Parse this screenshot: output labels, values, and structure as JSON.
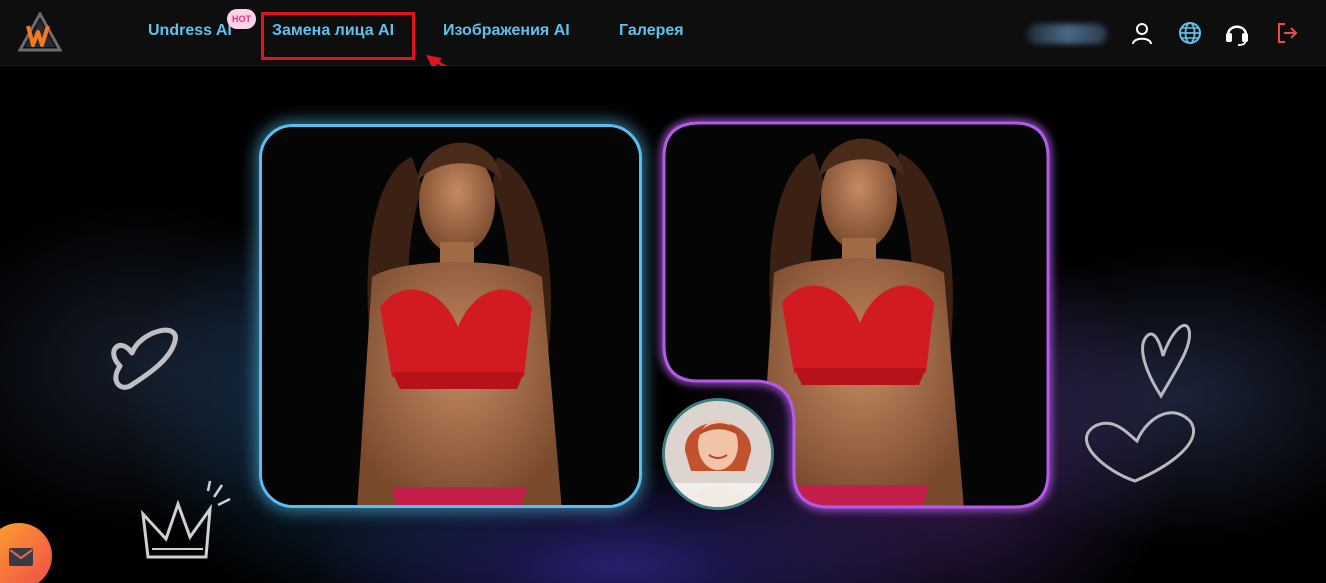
{
  "app": {
    "logo_icon": "w-triangle-logo-icon",
    "accent_color": "#62c0ea"
  },
  "nav": {
    "items": [
      {
        "label": "Undress AI",
        "badge": "HOT"
      },
      {
        "label": "Замена лица AI",
        "highlighted": true
      },
      {
        "label": "Изображения AI"
      },
      {
        "label": "Галерея"
      }
    ],
    "right_icons": [
      "user-icon",
      "globe-icon",
      "headset-icon",
      "logout-icon"
    ],
    "highlight_color": "#e0141c"
  },
  "showcase": {
    "source_image_icon": "woman-red-top-photo",
    "result_image_icon": "woman-red-top-face-swapped-photo",
    "face_image_icon": "redhead-woman-face-photo",
    "left_border_color": "#59bff0",
    "right_border_color": "#b059e6"
  },
  "floating": {
    "mail_icon": "mail-icon"
  }
}
